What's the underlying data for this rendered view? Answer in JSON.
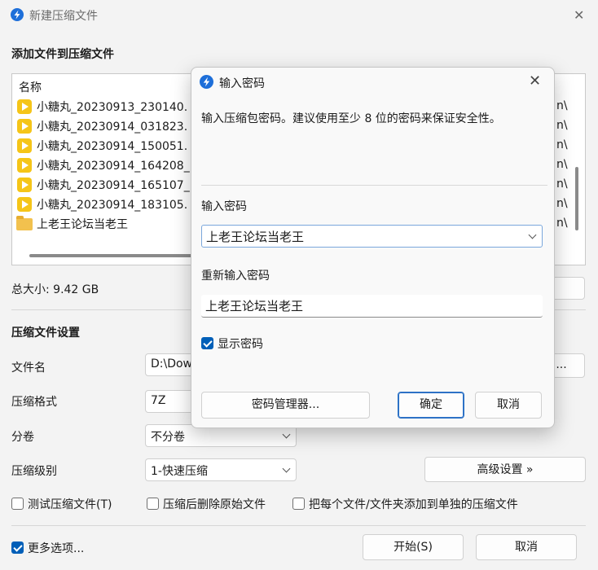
{
  "window": {
    "title": "新建压缩文件",
    "close_label": "✕"
  },
  "add_files": {
    "section_title": "添加文件到压缩文件",
    "column_name": "名称",
    "files": [
      {
        "name": "小糖丸_20230913_230140.",
        "type": "video"
      },
      {
        "name": "小糖丸_20230914_031823.",
        "type": "video"
      },
      {
        "name": "小糖丸_20230914_150051.",
        "type": "video"
      },
      {
        "name": "小糖丸_20230914_164208_",
        "type": "video"
      },
      {
        "name": "小糖丸_20230914_165107_",
        "type": "video"
      },
      {
        "name": "小糖丸_20230914_183105.",
        "type": "video"
      },
      {
        "name": "上老王论坛当老王",
        "type": "folder"
      }
    ],
    "right_fragments": [
      "n\\",
      "n\\",
      "n\\",
      "n\\",
      "n\\",
      "n\\",
      "n\\"
    ],
    "total_size": "总大小: 9.42 GB"
  },
  "settings": {
    "section_title": "压缩文件设置",
    "filename_label": "文件名",
    "filename_value": "D:\\Dow",
    "browse_label": "...",
    "format_label": "压缩格式",
    "format_value": "7Z",
    "volume_label": "分卷",
    "volume_value": "不分卷",
    "level_label": "压缩级别",
    "level_value": "1-快速压缩",
    "advanced_button": "高级设置 »"
  },
  "options": {
    "test_archive": {
      "label": "测试压缩文件(T)",
      "checked": false
    },
    "delete_after": {
      "label": "压缩后删除原始文件",
      "checked": false
    },
    "each_separate": {
      "label": "把每个文件/文件夹添加到单独的压缩文件",
      "checked": false
    },
    "more_options": {
      "label": "更多选项...",
      "checked": true
    }
  },
  "footer": {
    "start_button": "开始(S)",
    "cancel_button": "取消"
  },
  "dialog": {
    "title": "输入密码",
    "close_label": "✕",
    "description": "输入压缩包密码。建议使用至少 8 位的密码来保证安全性。",
    "password_label": "输入密码",
    "password_value": "上老王论坛当老王",
    "reenter_label": "重新输入密码",
    "reenter_value": "上老王论坛当老王",
    "show_password_label": "显示密码",
    "show_password_checked": true,
    "manager_button": "密码管理器...",
    "ok_button": "确定",
    "cancel_button": "取消"
  },
  "colors": {
    "accent": "#005fb8",
    "bolt_icon": "#1e6fd9",
    "video_icon": "#f5c518",
    "folder_icon": "#f2c14e"
  }
}
